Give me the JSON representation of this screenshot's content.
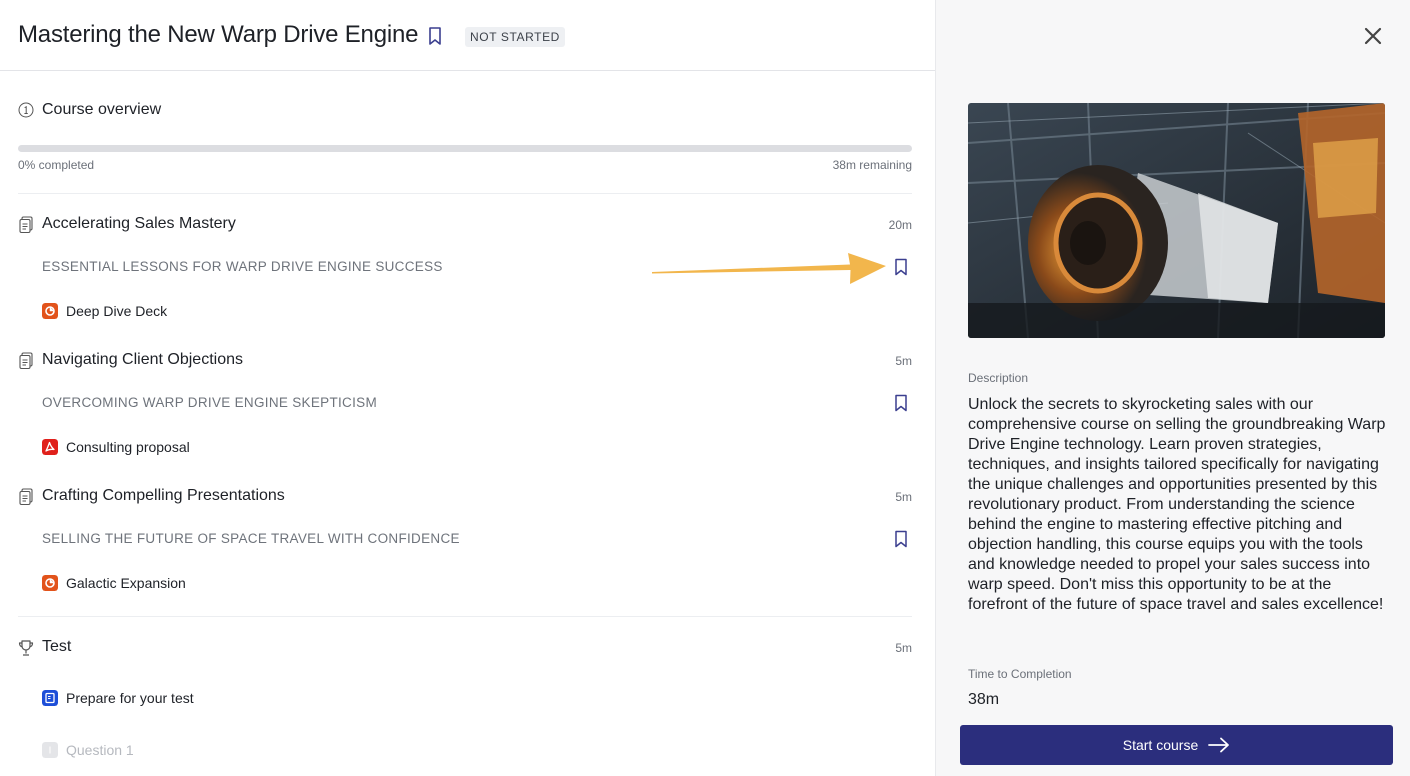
{
  "header": {
    "title": "Mastering the New Warp Drive Engine",
    "status": "NOT STARTED"
  },
  "overview": {
    "label": "Course overview",
    "progress_percent": 0,
    "progress_text": "0% completed",
    "remaining_text": "38m remaining"
  },
  "sections": [
    {
      "title": "Accelerating Sales Mastery",
      "duration": "20m",
      "subheading": "ESSENTIAL LESSONS FOR WARP DRIVE ENGINE SUCCESS",
      "item": {
        "label": "Deep Dive Deck",
        "icon": "presentation-icon"
      }
    },
    {
      "title": "Navigating Client Objections",
      "duration": "5m",
      "subheading": "OVERCOMING WARP DRIVE ENGINE SKEPTICISM",
      "item": {
        "label": "Consulting proposal",
        "icon": "pdf-icon"
      }
    },
    {
      "title": "Crafting Compelling Presentations",
      "duration": "5m",
      "subheading": "SELLING THE FUTURE OF SPACE TRAVEL WITH CONFIDENCE",
      "item": {
        "label": "Galactic Expansion",
        "icon": "presentation-icon"
      }
    }
  ],
  "test": {
    "title": "Test",
    "duration": "5m",
    "items": [
      {
        "label": "Prepare for your test",
        "icon": "document-icon"
      },
      {
        "label": "Question 1",
        "icon": "question-icon"
      }
    ]
  },
  "sidebar": {
    "description_label": "Description",
    "description": "Unlock the secrets to skyrocketing sales with our comprehensive course on selling the groundbreaking Warp Drive Engine technology. Learn proven strategies, techniques, and insights tailored specifically for navigating the unique challenges and opportunities presented by this revolutionary product. From understanding the science behind the engine to mastering effective pitching and objection handling, this course equips you with the tools and knowledge needed to propel your sales success into warp speed. Don't miss this opportunity to be at the forefront of the future of space travel and sales excellence!",
    "time_label": "Time to Completion",
    "time_value": "38m",
    "start_button": "Start course"
  },
  "colors": {
    "accent": "#2b2e7d",
    "bookmark": "#3b3f8f",
    "presentation_icon": "#e2531b",
    "pdf_icon": "#e0201b",
    "document_icon": "#1d4ed8",
    "annotation_arrow": "#f2b64c"
  }
}
